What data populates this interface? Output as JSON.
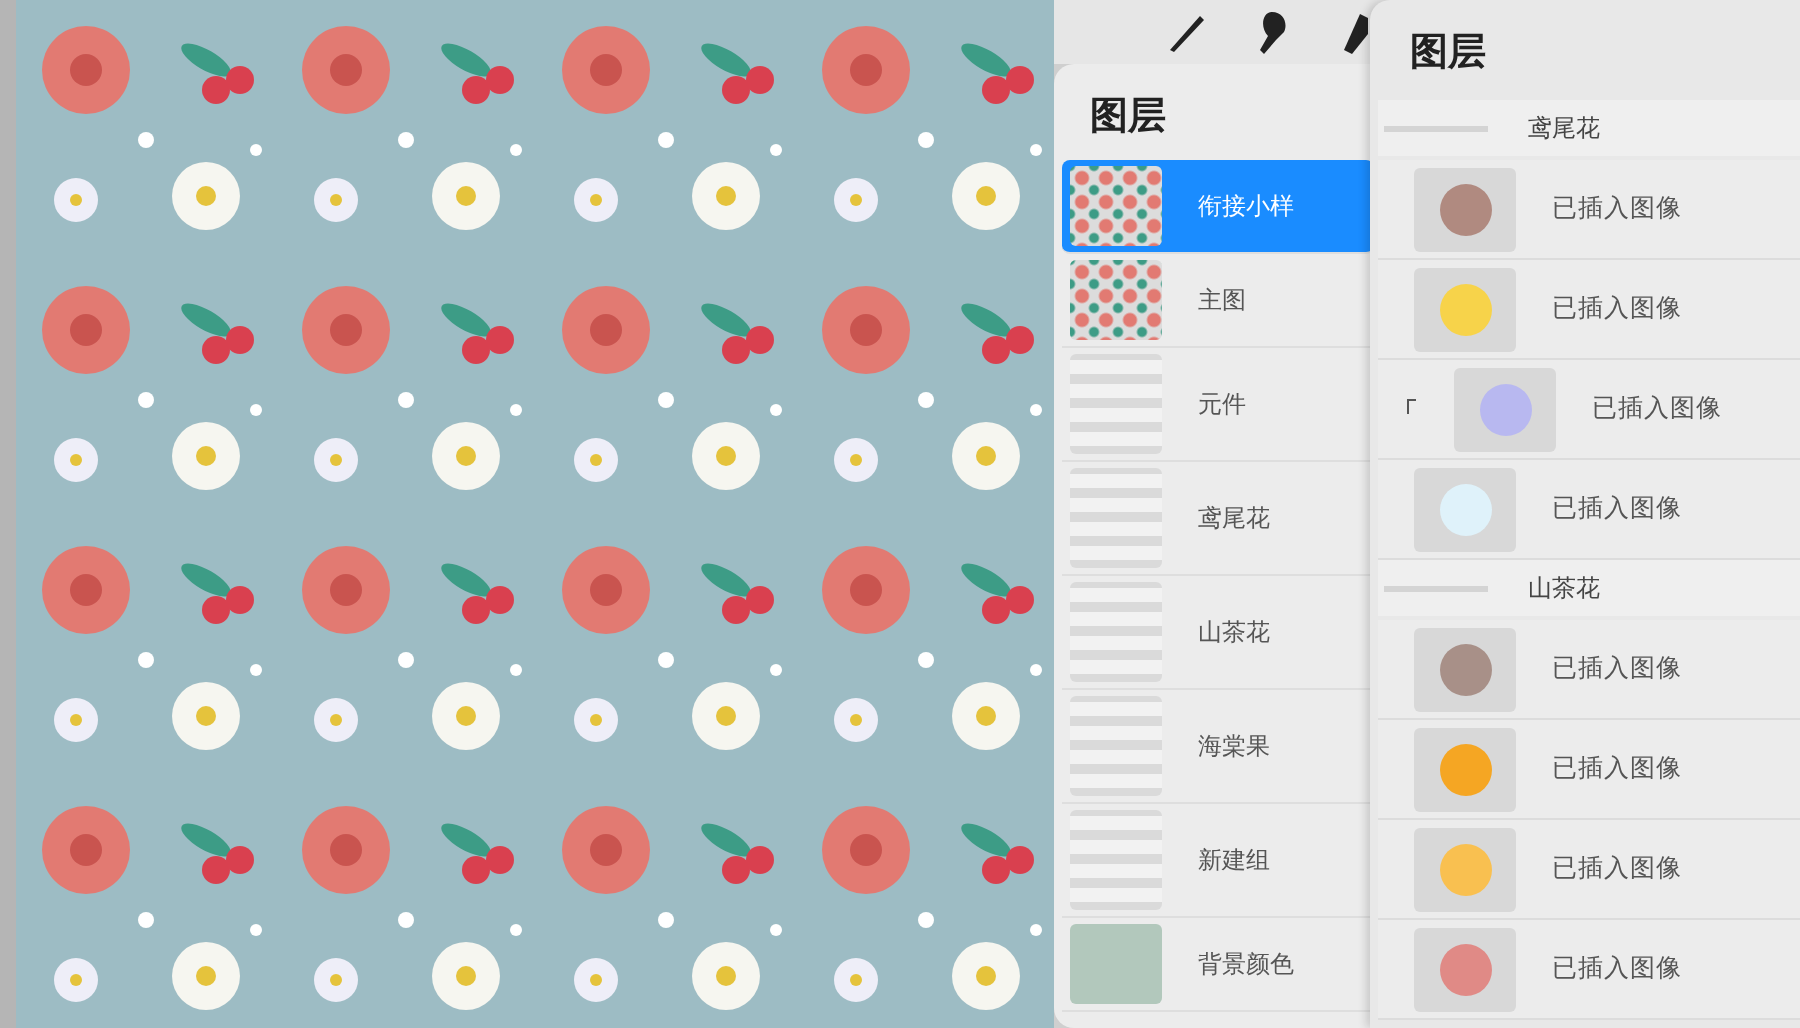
{
  "layers_panel": {
    "title": "图层",
    "layers": [
      {
        "name": "衔接小样",
        "kind": "pattern",
        "selected": true
      },
      {
        "name": "主图",
        "kind": "pattern",
        "selected": false
      },
      {
        "name": "元件",
        "kind": "group",
        "selected": false
      },
      {
        "name": "鸢尾花",
        "kind": "group",
        "selected": false
      },
      {
        "name": "山茶花",
        "kind": "group",
        "selected": false
      },
      {
        "name": "海棠果",
        "kind": "group",
        "selected": false
      },
      {
        "name": "新建组",
        "kind": "group",
        "selected": false
      },
      {
        "name": "背景颜色",
        "kind": "background",
        "selected": false,
        "color": "#b2c8bc"
      }
    ]
  },
  "group_panel": {
    "title": "图层",
    "groups": [
      {
        "name": "鸢尾花",
        "layers": [
          {
            "name": "已插入图像",
            "clipped": false,
            "color": "#b08a80"
          },
          {
            "name": "已插入图像",
            "clipped": false,
            "color": "#f7d34a"
          },
          {
            "name": "已插入图像",
            "clipped": true,
            "color": "#b8b8f0"
          },
          {
            "name": "已插入图像",
            "clipped": false,
            "color": "#dff2fa"
          }
        ]
      },
      {
        "name": "山茶花",
        "layers": [
          {
            "name": "已插入图像",
            "clipped": false,
            "color": "#a89088"
          },
          {
            "name": "已插入图像",
            "clipped": false,
            "color": "#f5a623"
          },
          {
            "name": "已插入图像",
            "clipped": false,
            "color": "#f9c050"
          },
          {
            "name": "已插入图像",
            "clipped": false,
            "color": "#e08a86"
          }
        ]
      }
    ]
  }
}
